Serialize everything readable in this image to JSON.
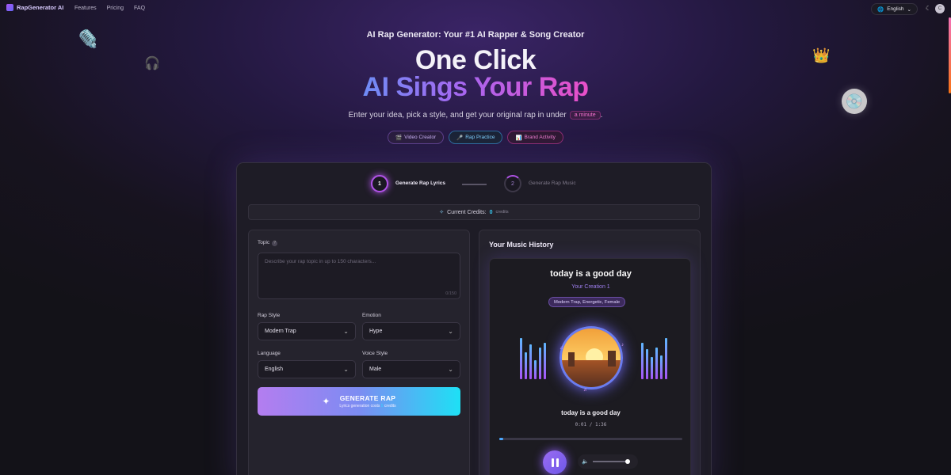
{
  "nav": {
    "brand": "RapGenerator AI",
    "links": [
      "Features",
      "Pricing",
      "FAQ"
    ],
    "language": "English",
    "avatar_initial": "C"
  },
  "hero": {
    "subtitle": "AI Rap Generator: Your #1 AI Rapper & Song Creator",
    "headline_line1": "One Click",
    "headline_line2": "AI Sings Your Rap",
    "tagline": "Enter your idea, pick a style, and get your original rap in under",
    "tagline_pill": "a minute",
    "tagline_end": ".",
    "chips": [
      "Video Creator",
      "Rap Practice",
      "Brand Activity"
    ]
  },
  "steps": {
    "step1_num": "1",
    "step1_label": "Generate Rap Lyrics",
    "step2_num": "2",
    "step2_label": "Generate Rap Music"
  },
  "credits": {
    "label": "Current Credits:",
    "value": "0",
    "unit": "credits"
  },
  "form": {
    "topic_label": "Topic",
    "topic_placeholder": "Describe your rap topic in up to 150 characters...",
    "topic_counter": "0/150",
    "rap_style_label": "Rap Style",
    "rap_style_value": "Modern Trap",
    "emotion_label": "Emotion",
    "emotion_value": "Hype",
    "language_label": "Language",
    "language_value": "English",
    "voice_label": "Voice Style",
    "voice_value": "Male",
    "generate_label": "GENERATE RAP",
    "generate_sub_prefix": "Lyrics generation costs",
    "generate_sub_num": "5",
    "generate_sub_suffix": "credits"
  },
  "history": {
    "title": "Your Music History",
    "song_title": "today is a good day",
    "creation": "Your Creation 1",
    "tags": "Modern Trap, Energetic, Female",
    "now_playing": "today is a good day",
    "current_time": "0:01",
    "separator": "/",
    "total_time": "1:36",
    "progress_fraction": 0.02
  }
}
